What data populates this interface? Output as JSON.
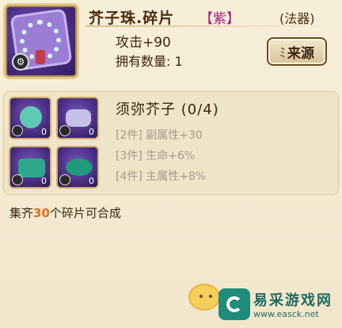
{
  "header": {
    "title": "芥子珠.碎片",
    "grade": "【紫】",
    "type": "(法器)",
    "attack": "攻击+90",
    "owned": "拥有数量: 1",
    "source_button": "来源"
  },
  "set": {
    "name": "须弥芥子 (0/4)",
    "bonuses": [
      "[2件] 副属性+30",
      "[3件] 生命+6%",
      "[4件] 主属性+8%"
    ],
    "slots": [
      {
        "count": "0",
        "icon": "bead-necklace-icon"
      },
      {
        "count": "0",
        "icon": "amulet-icon"
      },
      {
        "count": "0",
        "icon": "robe-icon"
      },
      {
        "count": "0",
        "icon": "hat-icon"
      }
    ]
  },
  "footer": {
    "prefix": "集齐",
    "number": "30",
    "suffix": "个碎片可合成"
  },
  "watermark": {
    "text": "易采游戏网",
    "url": "www.easck.net"
  },
  "colors": {
    "background": "#f3ead2",
    "grade": "#a21e7f",
    "highlight_number": "#d8711a",
    "muted": "#a8998a"
  }
}
